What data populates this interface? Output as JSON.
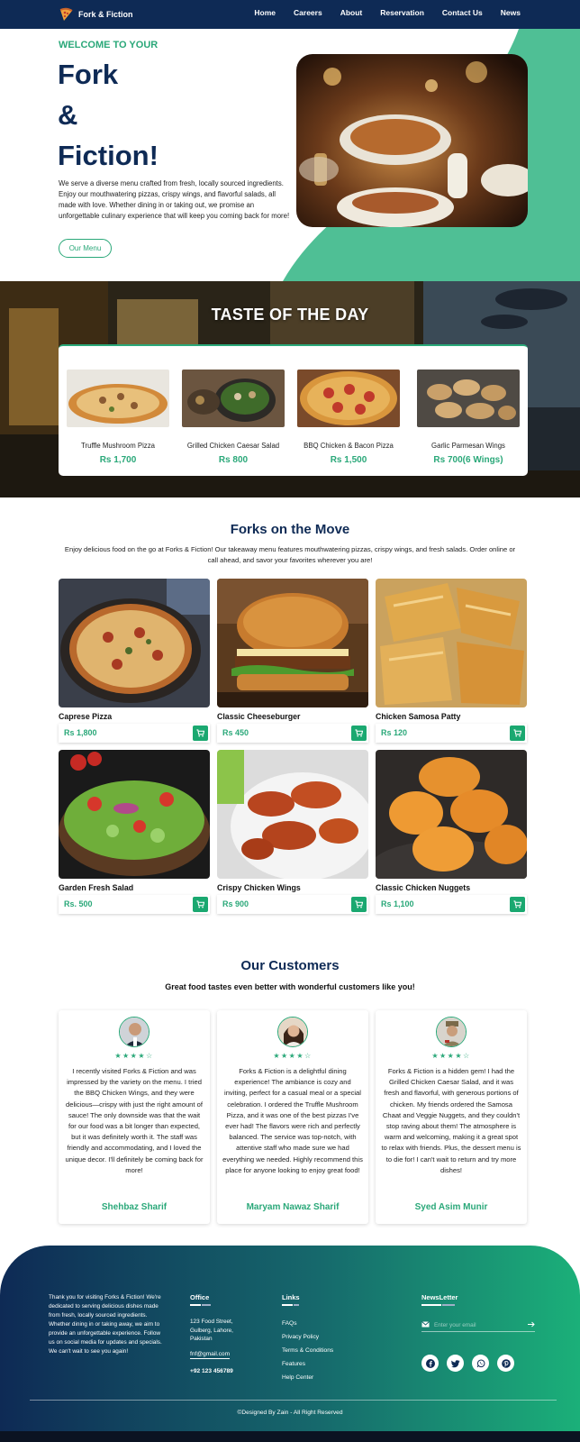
{
  "nav": {
    "brand": "Fork & Fiction",
    "links": [
      "Home",
      "Careers",
      "About",
      "Reservation",
      "Contact Us",
      "News"
    ]
  },
  "hero": {
    "welcome": "WELCOME TO YOUR",
    "title_lines": [
      "Fork",
      "&",
      "Fiction!"
    ],
    "description": "We serve a diverse menu crafted from fresh, locally sourced ingredients. Enjoy our mouthwatering pizzas, crispy wings, and flavorful salads, all made with love. Whether dining in or taking out, we promise an unforgettable culinary experience that will keep you coming back for more!",
    "button": "Our Menu"
  },
  "taste": {
    "title": "TASTE OF THE DAY",
    "items": [
      {
        "name": "Truffle Mushroom Pizza",
        "price": "Rs 1,700"
      },
      {
        "name": "Grilled Chicken Caesar Salad",
        "price": "Rs 800"
      },
      {
        "name": "BBQ Chicken & Bacon Pizza",
        "price": "Rs 1,500"
      },
      {
        "name": "Garlic Parmesan Wings",
        "price": "Rs 700(6 Wings)"
      }
    ]
  },
  "move": {
    "title": "Forks on the Move",
    "description": "Enjoy delicious food on the go at Forks & Fiction! Our takeaway menu features mouthwatering pizzas, crispy wings, and fresh salads. Order online or call ahead, and savor your favorites wherever you are!",
    "products": [
      {
        "name": "Caprese Pizza",
        "price": "Rs 1,800"
      },
      {
        "name": "Classic Cheeseburger",
        "price": "Rs 450"
      },
      {
        "name": "Chicken Samosa Patty",
        "price": "Rs 120"
      },
      {
        "name": "Garden Fresh Salad",
        "price": "Rs. 500"
      },
      {
        "name": "Crispy Chicken Wings",
        "price": "Rs 900"
      },
      {
        "name": "Classic Chicken Nuggets",
        "price": "Rs 1,100"
      }
    ]
  },
  "customers": {
    "title": "Our Customers",
    "subtitle": "Great food tastes even better with wonderful customers like you!",
    "stars": "★★★★☆",
    "reviews": [
      {
        "text": "I recently visited Forks & Fiction and was impressed by the variety on the menu. I tried the BBQ Chicken Wings, and they were delicious—crispy with just the right amount of sauce! The only downside was that the wait for our food was a bit longer than expected, but it was definitely worth it. The staff was friendly and accommodating, and I loved the unique decor. I'll definitely be coming back for more!",
        "name": "Shehbaz Sharif"
      },
      {
        "text": "Forks & Fiction is a delightful dining experience! The ambiance is cozy and inviting, perfect for a casual meal or a special celebration. I ordered the Truffle Mushroom Pizza, and it was one of the best pizzas I've ever had! The flavors were rich and perfectly balanced. The service was top-notch, with attentive staff who made sure we had everything we needed. Highly recommend this place for anyone looking to enjoy great food!",
        "name": "Maryam Nawaz Sharif"
      },
      {
        "text": "Forks & Fiction is a hidden gem! I had the Grilled Chicken Caesar Salad, and it was fresh and flavorful, with generous portions of chicken. My friends ordered the Samosa Chaat and Veggie Nuggets, and they couldn't stop raving about them! The atmosphere is warm and welcoming, making it a great spot to relax with friends. Plus, the dessert menu is to die for! I can't wait to return and try more dishes!",
        "name": "Syed Asim Munir"
      }
    ]
  },
  "footer": {
    "about": "Thank you for visiting Forks & Fiction! We're dedicated to serving delicious dishes made from fresh, locally sourced ingredients. Whether dining in or taking away, we aim to provide an unforgettable experience. Follow us on social media for updates and specials. We can't wait to see you again!",
    "office_title": "Office",
    "address": "123 Food Street, Gulberg, Lahore, Pakistan",
    "email": "fnf@gmail.com",
    "phone": "+92 123 456789",
    "links_title": "Links",
    "links": [
      "FAQs",
      "Privacy Policy",
      "Terms & Conditions",
      "Features",
      "Help Center"
    ],
    "newsletter_title": "NewsLetter",
    "newsletter_placeholder": "Enter your email",
    "copyright": "©Designed By Zain - All Right Reserved"
  },
  "colors": {
    "navy": "#0e2a55",
    "green": "#2aa879",
    "mint": "#4fbf95"
  }
}
